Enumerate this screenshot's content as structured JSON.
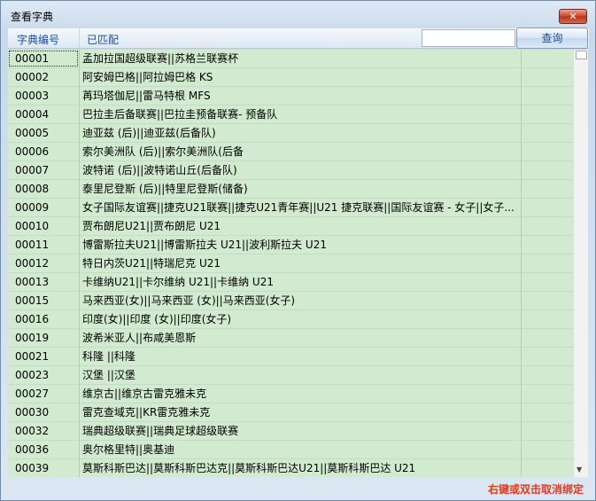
{
  "window": {
    "title": "查看字典",
    "close_label": "✕"
  },
  "header": {
    "col_code": "字典编号",
    "col_matched": "已匹配",
    "search_value": "",
    "query_label": "查询"
  },
  "rows": [
    {
      "code": "00001",
      "name": "孟加拉国超级联赛||苏格兰联赛杯"
    },
    {
      "code": "00002",
      "name": "阿安姆巴格||阿拉姆巴格 KS"
    },
    {
      "code": "00003",
      "name": "苒玛塔伽尼||雷马特根 MFS"
    },
    {
      "code": "00004",
      "name": "巴拉圭后备联赛||巴拉圭预备联赛- 预备队"
    },
    {
      "code": "00005",
      "name": "迪亚兹 (后)||迪亚兹(后备队)"
    },
    {
      "code": "00006",
      "name": "索尔美洲队 (后)||索尔美洲队(后备"
    },
    {
      "code": "00007",
      "name": "波特诺 (后)||波特诺山丘(后备队)"
    },
    {
      "code": "00008",
      "name": "泰里尼登斯 (后)||特里尼登斯(储备)"
    },
    {
      "code": "00009",
      "name": "女子国际友谊赛||捷克U21联赛||捷克U21青年赛||U21 捷克联赛||国际友谊赛 - 女子||女子..."
    },
    {
      "code": "00010",
      "name": "贾布朗尼U21||贾布朗尼 U21"
    },
    {
      "code": "00011",
      "name": "博雷斯拉夫U21||博雷斯拉夫 U21||波利斯拉夫 U21"
    },
    {
      "code": "00012",
      "name": "特日内茨U21||特瑞尼克 U21"
    },
    {
      "code": "00013",
      "name": "卡维纳U21||卡尔维纳 U21||卡维纳 U21"
    },
    {
      "code": "00015",
      "name": "马来西亚(女)||马来西亚 (女)||马来西亚(女子)"
    },
    {
      "code": "00016",
      "name": "印度(女)||印度 (女)||印度(女子)"
    },
    {
      "code": "00019",
      "name": "波希米亚人||布咸美恩斯"
    },
    {
      "code": "00021",
      "name": "科隆 ||科隆"
    },
    {
      "code": "00023",
      "name": "汉堡 ||汉堡"
    },
    {
      "code": "00027",
      "name": "维京古||维京古雷克雅未克"
    },
    {
      "code": "00030",
      "name": "雷克查域克||KR雷克雅未克"
    },
    {
      "code": "00032",
      "name": "瑞典超级联赛||瑞典足球超级联赛"
    },
    {
      "code": "00036",
      "name": "奥尔格里特||奥基迪"
    },
    {
      "code": "00039",
      "name": "莫斯科斯巴达||莫斯科斯巴达克||莫斯科斯巴达U21||莫斯科斯巴达  U21"
    }
  ],
  "scrollbar": {
    "up_arrow": "▲",
    "down_arrow": "▼"
  },
  "status": {
    "hint": "右键或双击取消绑定"
  },
  "colors": {
    "grid_bg": "#d2ebd0",
    "hint_text": "#e03b1f",
    "header_text": "#1f4f95"
  }
}
